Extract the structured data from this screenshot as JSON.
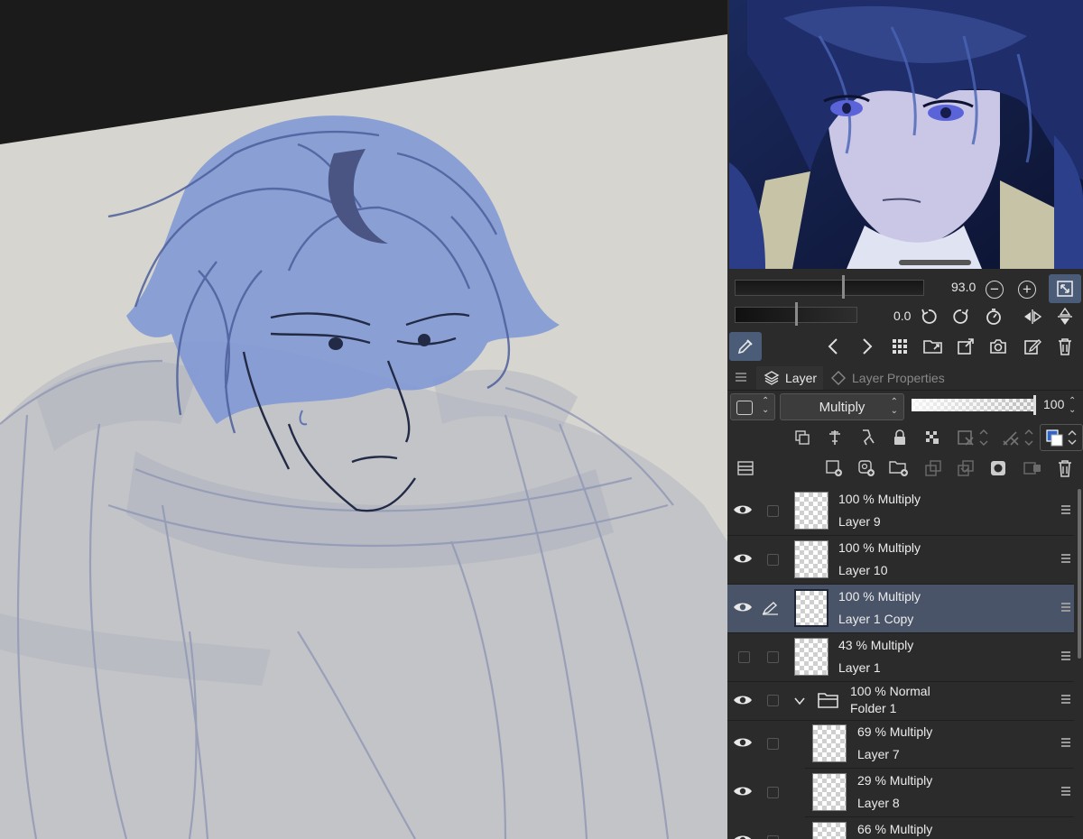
{
  "navigator": {
    "zoom_value": "93.0",
    "rotation_value": "0.0"
  },
  "layer_panel": {
    "tabs": {
      "layer": "Layer",
      "properties": "Layer Properties"
    },
    "blend_mode": "Multiply",
    "opacity": "100"
  },
  "layers": [
    {
      "info": "100 % Multiply",
      "name": "Layer 9",
      "visible": true
    },
    {
      "info": "100 % Multiply",
      "name": "Layer 10",
      "visible": true
    },
    {
      "info": "100 % Multiply",
      "name": "Layer 1 Copy",
      "visible": true,
      "selected": true
    },
    {
      "info": "43 % Multiply",
      "name": "Layer 1",
      "visible": false
    },
    {
      "info": "100 % Normal",
      "name": "Folder 1",
      "visible": true,
      "folder": true
    },
    {
      "info": "69 % Multiply",
      "name": "Layer 7",
      "visible": true,
      "indented": true
    },
    {
      "info": "29 % Multiply",
      "name": "Layer 8",
      "visible": true,
      "indented": true
    },
    {
      "info": "66 % Multiply",
      "name": "",
      "visible": true,
      "indented": true
    }
  ],
  "colors": {
    "panel_bg": "#2b2b2b",
    "selected_row": "#4a5468",
    "canvas_paper": "#d6d5cf",
    "sketch_blue": "#7c97d6"
  }
}
